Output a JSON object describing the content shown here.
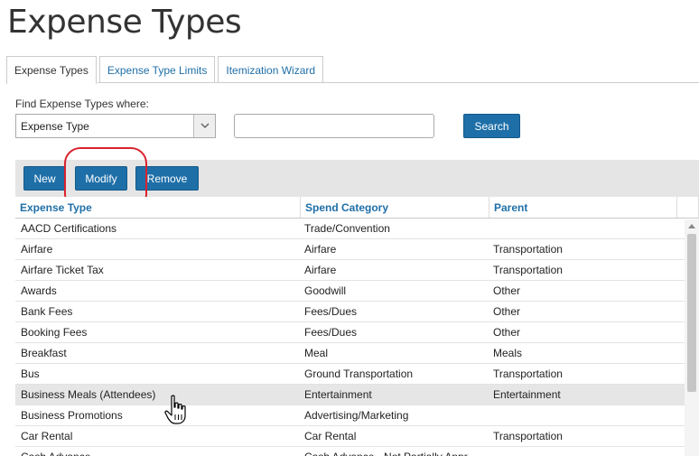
{
  "page": {
    "title": "Expense Types"
  },
  "tabs": [
    {
      "label": "Expense Types",
      "active": true
    },
    {
      "label": "Expense Type Limits",
      "active": false
    },
    {
      "label": "Itemization Wizard",
      "active": false
    }
  ],
  "search": {
    "find_label": "Find Expense Types where:",
    "field_value": "Expense Type",
    "input_value": "",
    "button_label": "Search"
  },
  "toolbar": {
    "new_label": "New",
    "modify_label": "Modify",
    "remove_label": "Remove"
  },
  "grid": {
    "columns": [
      "Expense Type",
      "Spend Category",
      "Parent"
    ],
    "rows": [
      [
        "AACD Certifications",
        "Trade/Convention",
        ""
      ],
      [
        "Airfare",
        "Airfare",
        "Transportation"
      ],
      [
        "Airfare Ticket Tax",
        "Airfare",
        "Transportation"
      ],
      [
        "Awards",
        "Goodwill",
        "Other"
      ],
      [
        "Bank Fees",
        "Fees/Dues",
        "Other"
      ],
      [
        "Booking Fees",
        "Fees/Dues",
        "Other"
      ],
      [
        "Breakfast",
        "Meal",
        "Meals"
      ],
      [
        "Bus",
        "Ground Transportation",
        "Transportation"
      ],
      [
        "Business Meals (Attendees)",
        "Entertainment",
        "Entertainment"
      ],
      [
        "Business Promotions",
        "Advertising/Marketing",
        ""
      ],
      [
        "Car Rental",
        "Car Rental",
        "Transportation"
      ],
      [
        "Cash Advance",
        "Cash Advance - Not Partially Appr",
        ""
      ]
    ],
    "hovered_row": 8
  },
  "colors": {
    "accent": "#1e6fa8",
    "highlight_ring": "#d9232d",
    "toolbar_bg": "#e5e5e5"
  },
  "icons": {
    "dropdown": "chevron-down-icon",
    "cursor": "hand-pointer-icon",
    "scroll_up": "arrow-up-icon"
  }
}
